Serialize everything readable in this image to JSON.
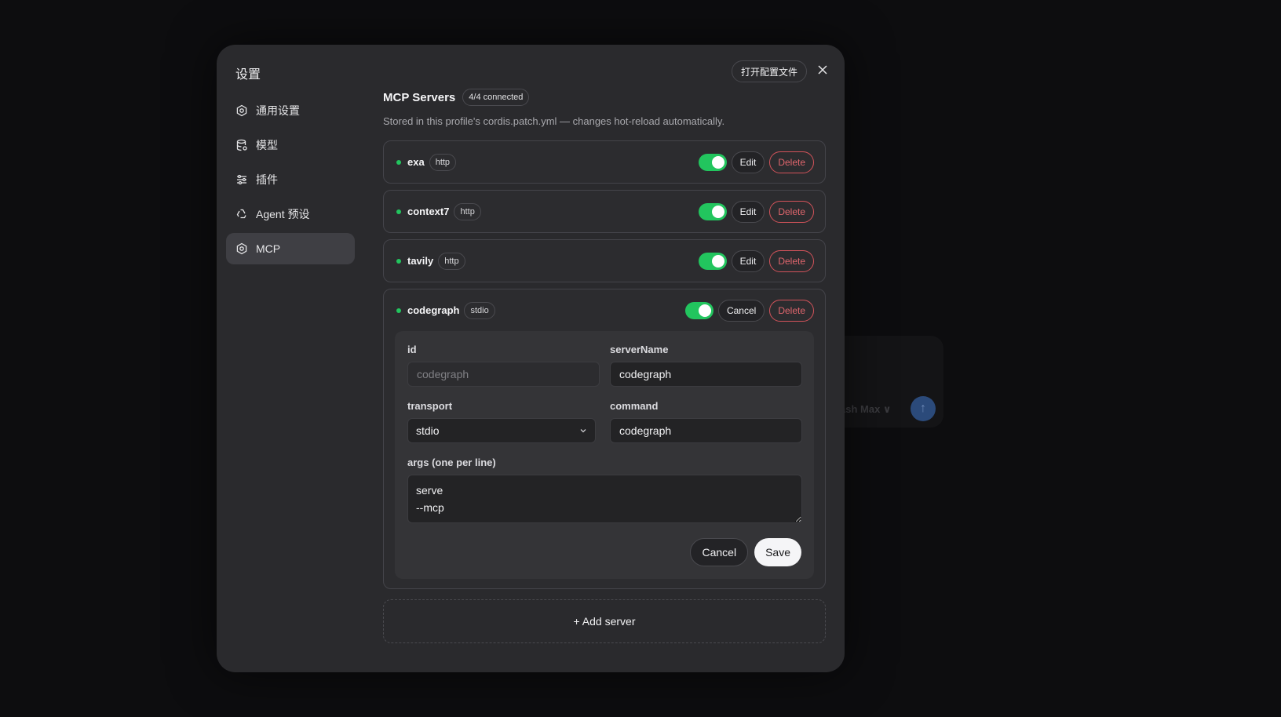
{
  "background": {
    "hint_text": "ash Max ∨"
  },
  "modal": {
    "title": "设置",
    "open_config_label": "打开配置文件"
  },
  "nav": {
    "items": [
      {
        "label": "通用设置",
        "icon": "gear-icon"
      },
      {
        "label": "模型",
        "icon": "database-icon"
      },
      {
        "label": "插件",
        "icon": "sliders-icon"
      },
      {
        "label": "Agent 预设",
        "icon": "recycle-icon"
      },
      {
        "label": "MCP",
        "icon": "gear-icon",
        "active": true
      }
    ]
  },
  "mcp": {
    "heading": "MCP Servers",
    "connected_badge": "4/4 connected",
    "subtitle": "Stored in this profile's cordis.patch.yml — changes hot-reload automatically.",
    "servers": [
      {
        "name": "exa",
        "transport": "http",
        "enabled": true,
        "edit_label": "Edit",
        "delete_label": "Delete"
      },
      {
        "name": "context7",
        "transport": "http",
        "enabled": true,
        "edit_label": "Edit",
        "delete_label": "Delete"
      },
      {
        "name": "tavily",
        "transport": "http",
        "enabled": true,
        "edit_label": "Edit",
        "delete_label": "Delete"
      },
      {
        "name": "codegraph",
        "transport": "stdio",
        "enabled": true,
        "edit_label": "Cancel",
        "delete_label": "Delete"
      }
    ],
    "editor": {
      "id_label": "id",
      "id_value": "codegraph",
      "server_name_label": "serverName",
      "server_name_value": "codegraph",
      "transport_label": "transport",
      "transport_value": "stdio",
      "command_label": "command",
      "command_value": "codegraph",
      "args_label": "args (one per line)",
      "args_value": "serve\n--mcp",
      "cancel_label": "Cancel",
      "save_label": "Save"
    },
    "add_server_label": "+ Add server"
  },
  "colors": {
    "accent_green": "#22c55e",
    "danger": "#e0666d",
    "modal_bg": "#2a2a2d"
  }
}
